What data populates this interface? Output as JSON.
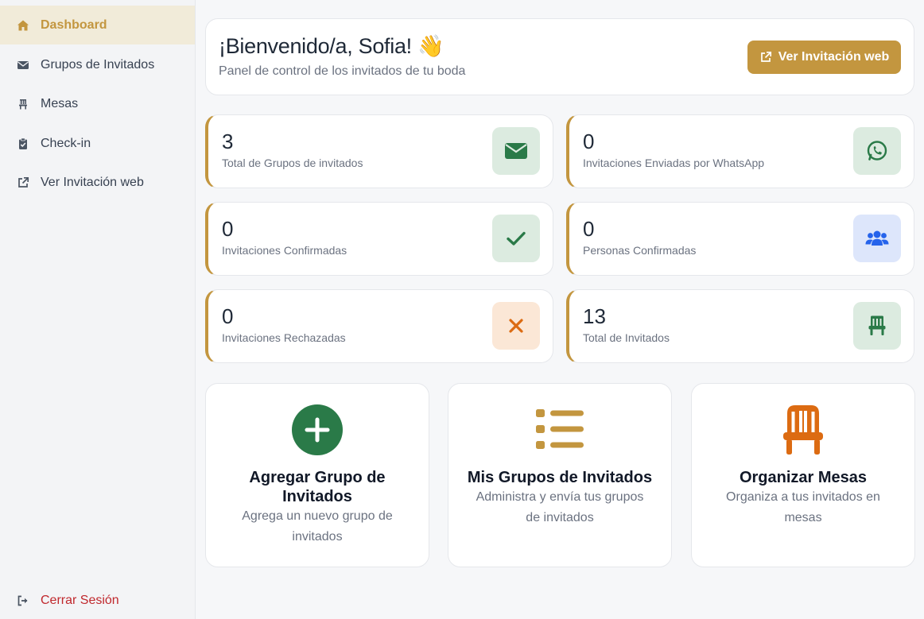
{
  "sidebar": {
    "items": [
      {
        "label": "Dashboard",
        "icon": "home-icon"
      },
      {
        "label": "Grupos de Invitados",
        "icon": "envelope-icon"
      },
      {
        "label": "Mesas",
        "icon": "chair-icon"
      },
      {
        "label": "Check-in",
        "icon": "clipboard-check-icon"
      },
      {
        "label": "Ver Invitación web",
        "icon": "external-link-icon"
      }
    ],
    "logout_label": "Cerrar Sesión"
  },
  "header": {
    "title": "¡Bienvenido/a, Sofia! 👋",
    "subtitle": "Panel de control de los invitados de tu boda",
    "web_button_label": "Ver Invitación web"
  },
  "stats": [
    {
      "value": "3",
      "label": "Total de Grupos de invitados",
      "icon": "envelope-icon"
    },
    {
      "value": "0",
      "label": "Invitaciones Enviadas por WhatsApp",
      "icon": "whatsapp-icon"
    },
    {
      "value": "0",
      "label": "Invitaciones Confirmadas",
      "icon": "check-icon"
    },
    {
      "value": "0",
      "label": "Personas Confirmadas",
      "icon": "users-icon"
    },
    {
      "value": "0",
      "label": "Invitaciones Rechazadas",
      "icon": "x-icon"
    },
    {
      "value": "13",
      "label": "Total de Invitados",
      "icon": "chair-icon"
    }
  ],
  "cards": [
    {
      "title": "Agregar Grupo de Invitados",
      "description": "Agrega un nuevo grupo de invitados"
    },
    {
      "title": "Mis Grupos de Invitados",
      "description": "Administra y envía tus grupos de invitados"
    },
    {
      "title": "Organizar Mesas",
      "description": "Organiza a tus invitados en mesas"
    }
  ],
  "colors": {
    "accent": "#c3963f",
    "green": "#2a7a48",
    "blue": "#2563eb",
    "orange": "#dc6b12",
    "logout": "#c0282d"
  }
}
